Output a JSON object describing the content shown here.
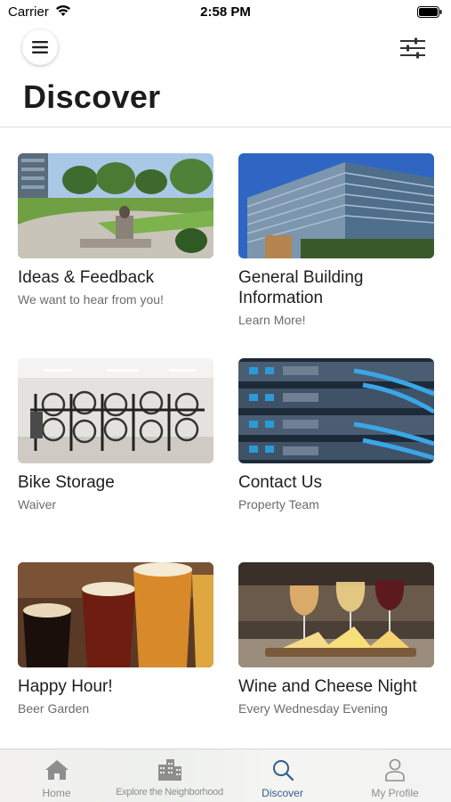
{
  "status_bar": {
    "carrier": "Carrier",
    "time": "2:58 PM"
  },
  "header": {
    "title": "Discover"
  },
  "cards": [
    {
      "title": "Ideas & Feedback",
      "subtitle": "We want to hear from you!"
    },
    {
      "title": "General Building Information",
      "subtitle": "Learn More!"
    },
    {
      "title": "Bike Storage",
      "subtitle": "Waiver"
    },
    {
      "title": "Contact Us",
      "subtitle": "Property Team"
    },
    {
      "title": "Happy Hour!",
      "subtitle": "Beer Garden"
    },
    {
      "title": "Wine and Cheese Night",
      "subtitle": "Every Wednesday Evening"
    }
  ],
  "tabs": [
    {
      "label": "Home",
      "icon": "home-icon"
    },
    {
      "label": "Explore the Neighborhood",
      "icon": "city-icon"
    },
    {
      "label": "Discover",
      "icon": "search-icon"
    },
    {
      "label": "My Profile",
      "icon": "profile-icon"
    }
  ],
  "colors": {
    "active_tab": "#2f5d8a",
    "inactive_tab": "#8e8e8e"
  }
}
